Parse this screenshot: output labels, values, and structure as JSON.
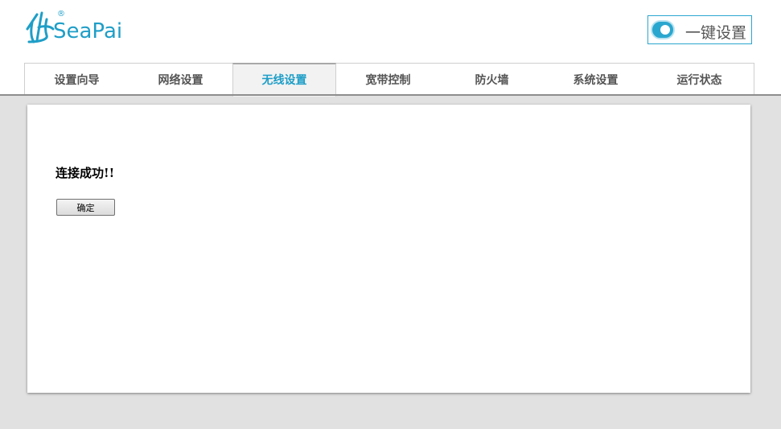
{
  "brand": {
    "logo_text": "SeaPai",
    "registered": "®",
    "accent_color": "#1e9ec7"
  },
  "onekey": {
    "label": "一键设置",
    "toggle_state": "on"
  },
  "nav": {
    "active_tab": "无线设置",
    "tabs": [
      {
        "label": "设置向导"
      },
      {
        "label": "网络设置"
      },
      {
        "label": "无线设置"
      },
      {
        "label": "宽带控制"
      },
      {
        "label": "防火墙"
      },
      {
        "label": "系统设置"
      },
      {
        "label": "运行状态"
      }
    ]
  },
  "main": {
    "message": "连接成功!!",
    "confirm_label": "确定"
  }
}
